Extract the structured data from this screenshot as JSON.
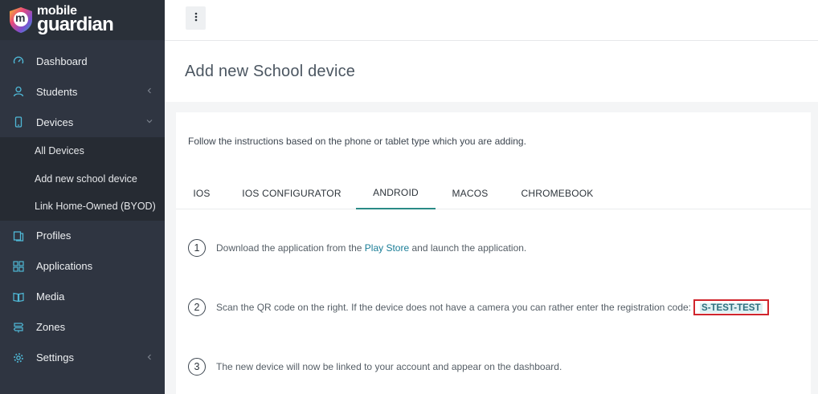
{
  "logo": {
    "line1": "mobile",
    "line2": "guardian",
    "badge": "m"
  },
  "sidebar": {
    "items": [
      {
        "label": "Dashboard",
        "icon": "gauge-icon"
      },
      {
        "label": "Students",
        "icon": "user-icon",
        "chevron": "chevron-left-icon"
      },
      {
        "label": "Devices",
        "icon": "phone-icon",
        "chevron": "chevron-down-icon"
      },
      {
        "label": "Profiles",
        "icon": "profiles-icon"
      },
      {
        "label": "Applications",
        "icon": "grid-icon"
      },
      {
        "label": "Media",
        "icon": "book-icon"
      },
      {
        "label": "Zones",
        "icon": "signpost-icon"
      },
      {
        "label": "Settings",
        "icon": "gear-icon",
        "chevron": "chevron-left-icon"
      }
    ],
    "devices_sub": [
      {
        "label": "All Devices"
      },
      {
        "label": "Add new school device"
      },
      {
        "label": "Link Home-Owned (BYOD)"
      }
    ]
  },
  "page": {
    "title": "Add new School device"
  },
  "card": {
    "intro": "Follow the instructions based on the phone or tablet type which you are adding.",
    "tabs": [
      {
        "label": "IOS"
      },
      {
        "label": "IOS CONFIGURATOR"
      },
      {
        "label": "ANDROID",
        "active": true
      },
      {
        "label": "MACOS"
      },
      {
        "label": "CHROMEBOOK"
      }
    ],
    "steps": [
      {
        "num": "1",
        "pre": "Download the application from the ",
        "link": "Play Store",
        "post": " and launch the application."
      },
      {
        "num": "2",
        "text": "Scan the QR code on the right. If the device does not have a camera you can rather enter the registration code:",
        "code": "S-TEST-TEST"
      },
      {
        "num": "3",
        "text": "The new device will now be linked to your account and appear on the dashboard."
      }
    ]
  },
  "colors": {
    "sidebar_bg": "#2f3541",
    "accent": "#2a8a86",
    "highlight": "#d1252d",
    "link": "#1a7d97"
  }
}
